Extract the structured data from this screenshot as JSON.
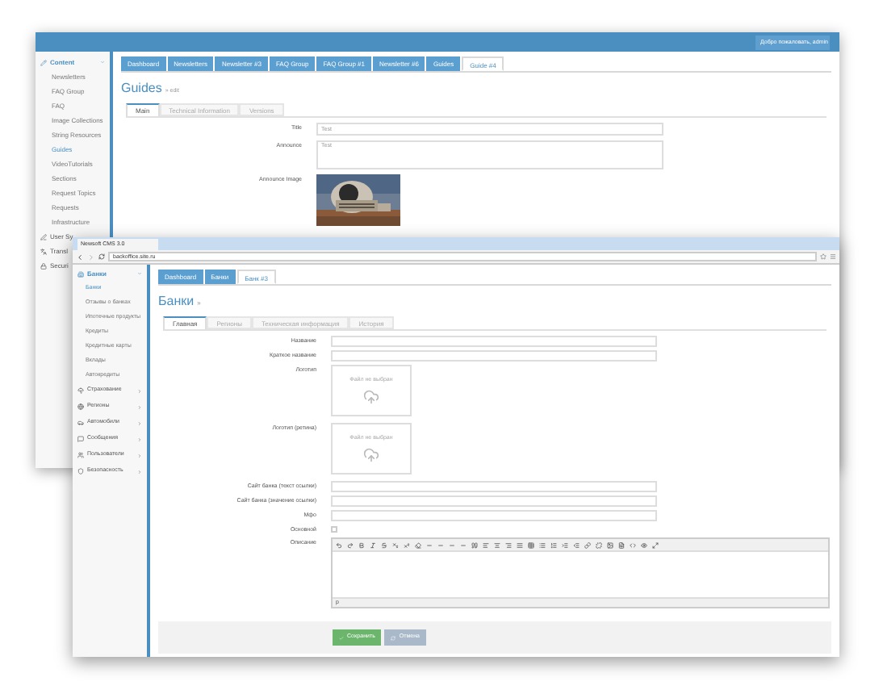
{
  "back_window": {
    "user_menu": "Добро пожаловать, admin",
    "sidebar": {
      "group": "Content",
      "expanded": true,
      "items": [
        {
          "label": "Newsletters",
          "selected": false
        },
        {
          "label": "FAQ Group",
          "selected": false
        },
        {
          "label": "FAQ",
          "selected": false
        },
        {
          "label": "Image Collections",
          "selected": false
        },
        {
          "label": "String Resources",
          "selected": false
        },
        {
          "label": "Guides",
          "selected": true
        },
        {
          "label": "VideoTutorials",
          "selected": false
        },
        {
          "label": "Sections",
          "selected": false
        },
        {
          "label": "Request Topics",
          "selected": false
        },
        {
          "label": "Requests",
          "selected": false
        },
        {
          "label": "Infrastructure",
          "selected": false
        }
      ],
      "groups": [
        "User Sy",
        "Transl",
        "Securi"
      ]
    },
    "tabs": [
      {
        "label": "Dashboard",
        "selected": false
      },
      {
        "label": "Newsletters",
        "selected": false
      },
      {
        "label": "Newsletter #3",
        "selected": false
      },
      {
        "label": "FAQ Group",
        "selected": false
      },
      {
        "label": "FAQ Group #1",
        "selected": false
      },
      {
        "label": "Newsletter #6",
        "selected": false
      },
      {
        "label": "Guides",
        "selected": false
      },
      {
        "label": "Guide #4",
        "selected": true
      }
    ],
    "title": "Guides",
    "subtitle": "» edit",
    "form_tabs": [
      {
        "label": "Main",
        "selected": true
      },
      {
        "label": "Technical Information",
        "selected": false
      },
      {
        "label": "Versions",
        "selected": false
      }
    ],
    "fields": [
      {
        "kind": "text",
        "label": "Title",
        "value": "Test"
      },
      {
        "kind": "textarea",
        "label": "Announce",
        "value": "Test"
      },
      {
        "label": "Announce Image"
      }
    ]
  },
  "front_window": {
    "browser_tab": "Newsoft CMS 3.0",
    "address": "backoffice.site.ru",
    "sidebar": {
      "group": "Банки",
      "expanded": true,
      "items": [
        {
          "label": "Банки",
          "selected": true
        },
        {
          "label": "Отзывы о банках",
          "selected": false
        },
        {
          "label": "Ипотечные продукты",
          "selected": false
        },
        {
          "label": "Кредиты",
          "selected": false
        },
        {
          "label": "Кредитные карты",
          "selected": false
        },
        {
          "label": "Вклады",
          "selected": false
        },
        {
          "label": "Автокредиты",
          "selected": false
        }
      ],
      "groups": [
        {
          "label": "Страхование",
          "expanded": false
        },
        {
          "label": "Регионы",
          "expanded": false
        },
        {
          "label": "Автомобили",
          "expanded": false
        },
        {
          "label": "Сообщения",
          "expanded": false
        },
        {
          "label": "Пользователи",
          "expanded": false
        },
        {
          "label": "Безопасность",
          "expanded": false
        }
      ]
    },
    "tabs": [
      {
        "label": "Dashboard",
        "selected": false
      },
      {
        "label": "Банки",
        "selected": false
      },
      {
        "label": "Банк #3",
        "selected": true
      }
    ],
    "title": "Банки",
    "subtitle": "»",
    "form_tabs": [
      {
        "label": "Главная",
        "selected": true
      },
      {
        "label": "Регионы",
        "selected": false
      },
      {
        "label": "Техническая информация",
        "selected": false
      },
      {
        "label": "История",
        "selected": false
      }
    ],
    "fields": [
      {
        "kind": "text",
        "label": "Название"
      },
      {
        "kind": "text",
        "label": "Краткое название"
      },
      {
        "kind": "upload",
        "label": "Логотип",
        "placeholder": "Файл не выбран"
      },
      {
        "kind": "upload",
        "label": "Логотип (ретина)",
        "placeholder": "Файл не выбран"
      },
      {
        "kind": "text",
        "label": "Сайт банка (текст ссылки)"
      },
      {
        "kind": "text",
        "label": "Сайт банка (значение ссылки)"
      },
      {
        "kind": "text",
        "label": "Мфо"
      },
      {
        "kind": "checkbox",
        "label": "Основной",
        "checked": false
      },
      {
        "kind": "editor",
        "label": "Описание",
        "status": "p"
      }
    ],
    "buttons": [
      {
        "label": "Сохранить",
        "kind": "primary"
      },
      {
        "label": "Отмена",
        "kind": "secondary"
      }
    ]
  }
}
